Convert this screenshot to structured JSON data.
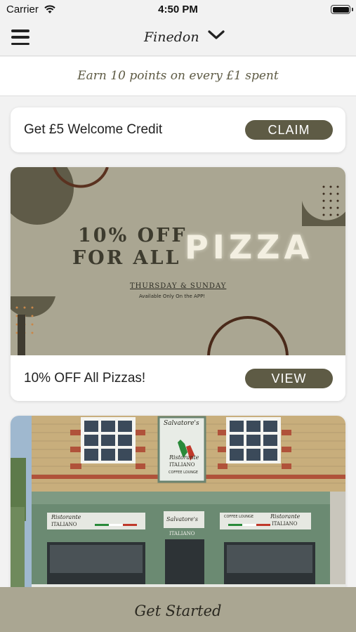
{
  "status_bar": {
    "carrier": "Carrier",
    "time": "4:50 PM",
    "wifi_icon": "wifi-icon",
    "battery_icon": "battery-icon"
  },
  "nav": {
    "menu_icon": "hamburger-menu-icon",
    "location": "Finedon",
    "dropdown_icon": "chevron-down-icon"
  },
  "earn_banner": {
    "text": "Earn 10 points on every £1 spent"
  },
  "welcome_card": {
    "label": "Get £5 Welcome Credit",
    "button": "CLAIM"
  },
  "promo_card": {
    "image": {
      "line1": "10% OFF",
      "line2": "FOR ALL",
      "highlight": "PIZZA",
      "days": "THURSDAY & SUNDAY",
      "note": "Available Only On the APP!"
    },
    "label": "10% OFF All Pizzas!",
    "button": "VIEW"
  },
  "restaurant_card": {
    "signs": {
      "hanging_top": "Salvatore's",
      "hanging_mid": "Ristorante",
      "hanging_bottom": "ITALIANO",
      "hanging_small": "COFFEE LOUNGE",
      "left_top": "Ristorante",
      "left_bottom": "ITALIANO",
      "center_top": "Salvatore's",
      "center_bottom": "ITALIANO",
      "right_small": "COFFEE LOUNGE",
      "right_top": "Ristorante",
      "right_bottom": "ITALIANO"
    }
  },
  "footer": {
    "button": "Get Started"
  },
  "colors": {
    "accent": "#5e5b45",
    "promo_bg": "#aaa692",
    "footer_bg": "#aaa692",
    "page_bg": "#f2f2f2"
  }
}
